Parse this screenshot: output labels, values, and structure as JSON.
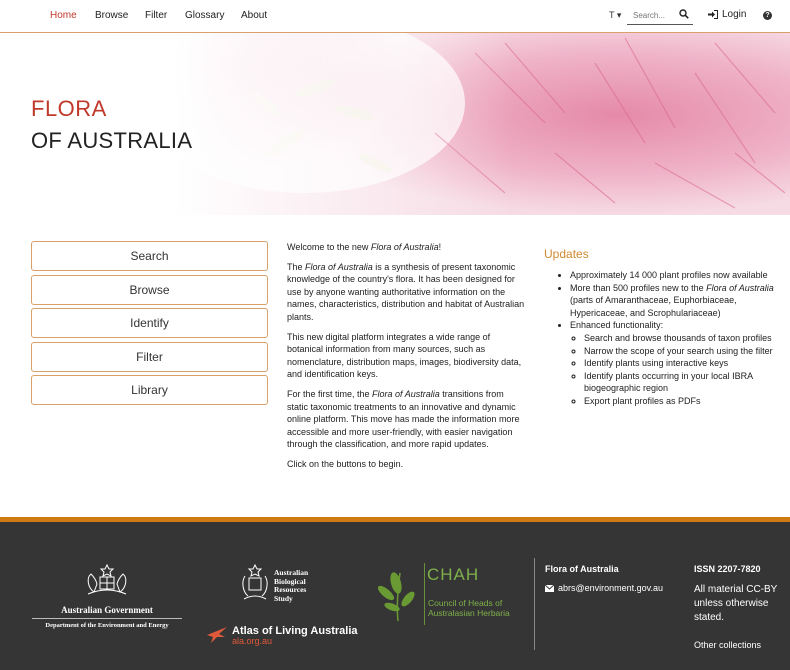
{
  "nav": {
    "items": [
      {
        "label": "Home",
        "active": true
      },
      {
        "label": "Browse"
      },
      {
        "label": "Filter"
      },
      {
        "label": "Glossary"
      },
      {
        "label": "About"
      }
    ],
    "search_type": "T",
    "search_placeholder": "Search...",
    "login_label": "Login",
    "help_icon": "question-circle-icon"
  },
  "hero": {
    "title_line1": "FLORA",
    "title_line2": "OF AUSTRALIA"
  },
  "buttons": [
    "Search",
    "Browse",
    "Identify",
    "Filter",
    "Library"
  ],
  "intro": {
    "welcome_prefix": "Welcome to the new ",
    "welcome_italic": "Flora of Australia",
    "welcome_suffix": "!",
    "p1_prefix": "The ",
    "p1_italic": "Flora of Australia",
    "p1_rest": " is a synthesis of present taxonomic knowledge of the country's flora. It has been designed for use by anyone wanting authoritative information on the names, characteristics, distribution and habitat of Australian plants.",
    "p2": "This new digital platform integrates a wide range of botanical information from many sources, such as nomenclature, distribution maps, images, biodiversity data, and identification keys.",
    "p3_prefix": "For the first time, the ",
    "p3_italic": "Flora of Australia",
    "p3_rest": " transitions from static taxonomic treatments to an innovative and dynamic online platform. This move has made the information more accessible and more user-friendly, with easier navigation through the classification, and more rapid updates.",
    "p4": "Click on the buttons to begin."
  },
  "updates": {
    "heading": "Updates",
    "item1": "Approximately 14 000 plant profiles now available",
    "item2_prefix": "More than 500 profiles new to the ",
    "item2_italic": "Flora of Australia",
    "item2_rest": " (parts of Amaranthaceae, Euphorbiaceae, Hypericaceae, and Scrophulariaceae)",
    "item3": "Enhanced functionality:",
    "sub_items": [
      "Search and browse thousands of taxon profiles",
      "Narrow the scope of your search using the filter",
      "Identify plants using interactive keys",
      "Identify plants occurring in your local IBRA biogeographic region",
      "Export plant profiles as PDFs"
    ]
  },
  "footer": {
    "gov_line1": "Australian Government",
    "gov_line2": "Department of the Environment and Energy",
    "abrs_lines": [
      "Australian",
      "Biological",
      "Resources",
      "Study"
    ],
    "ala_name": "Atlas of Living Australia",
    "ala_url": "ala.org.au",
    "chah_name": "CHAH",
    "chah_sub1": "Council of Heads of",
    "chah_sub2": "Australasian Herbaria",
    "fa_title": "Flora of Australia",
    "email": "abrs@environment.gov.au",
    "issn": "ISSN 2207-7820",
    "cc": "All material CC-BY unless otherwise stated.",
    "other": "Other collections"
  },
  "colors": {
    "accent_red": "#c0392b",
    "accent_orange": "#d08a2e",
    "button_border": "#d9a06a",
    "footer_bg": "#353535",
    "footer_rule": "#cf7a12"
  }
}
